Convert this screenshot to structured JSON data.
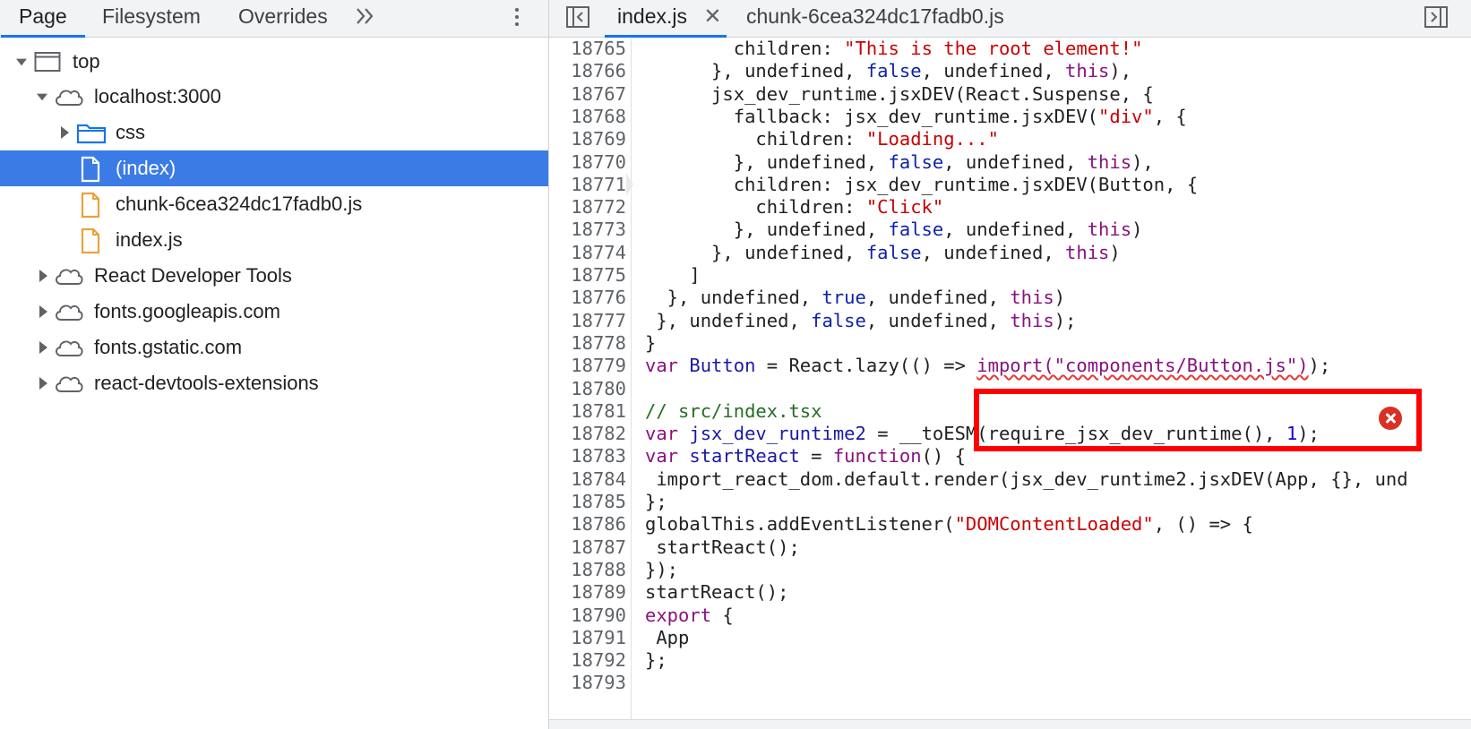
{
  "left_panel": {
    "tabs": [
      {
        "label": "Page",
        "active": true
      },
      {
        "label": "Filesystem",
        "active": false
      },
      {
        "label": "Overrides",
        "active": false
      }
    ],
    "more_tabs_icon": "double-chevron-right-icon",
    "menu_icon": "kebab-menu-icon",
    "tree": [
      {
        "label": "top",
        "type": "frame",
        "expanded": true,
        "depth": 0,
        "selected": false
      },
      {
        "label": "localhost:3000",
        "type": "origin",
        "expanded": true,
        "depth": 1,
        "selected": false
      },
      {
        "label": "css",
        "type": "folder",
        "expanded": false,
        "depth": 2,
        "selected": false
      },
      {
        "label": "(index)",
        "type": "document",
        "depth": 2,
        "selected": true
      },
      {
        "label": "chunk-6cea324dc17fadb0.js",
        "type": "script",
        "depth": 2,
        "selected": false
      },
      {
        "label": "index.js",
        "type": "script",
        "depth": 2,
        "selected": false
      },
      {
        "label": "React Developer Tools",
        "type": "origin",
        "expanded": false,
        "depth": 1,
        "selected": false
      },
      {
        "label": "fonts.googleapis.com",
        "type": "origin",
        "expanded": false,
        "depth": 1,
        "selected": false
      },
      {
        "label": "fonts.gstatic.com",
        "type": "origin",
        "expanded": false,
        "depth": 1,
        "selected": false
      },
      {
        "label": "react-devtools-extensions",
        "type": "origin",
        "expanded": false,
        "depth": 1,
        "selected": false
      }
    ]
  },
  "editor": {
    "tabs": [
      {
        "label": "index.js",
        "active": true,
        "closable": true
      },
      {
        "label": "chunk-6cea324dc17fadb0.js",
        "active": false,
        "closable": false
      }
    ],
    "toggle_navigator_icon": "sidebar-toggle-left-icon",
    "toggle_debugger_icon": "sidebar-toggle-right-icon",
    "current_line": "18771",
    "error_line": "18779",
    "lines": [
      {
        "n": "18765",
        "segs": [
          [
            "p",
            "        children: "
          ],
          [
            "s",
            "\"This is the root element!\""
          ]
        ]
      },
      {
        "n": "18766",
        "segs": [
          [
            "p",
            "      }, undefined, "
          ],
          [
            "b",
            "false"
          ],
          [
            "p",
            ", undefined, "
          ],
          [
            "k",
            "this"
          ],
          [
            "p",
            "),"
          ]
        ]
      },
      {
        "n": "18767",
        "segs": [
          [
            "p",
            "      jsx_dev_runtime.jsxDEV(React.Suspense, {"
          ]
        ]
      },
      {
        "n": "18768",
        "segs": [
          [
            "p",
            "        fallback: jsx_dev_runtime.jsxDEV("
          ],
          [
            "s",
            "\"div\""
          ],
          [
            "p",
            ", {"
          ]
        ]
      },
      {
        "n": "18769",
        "segs": [
          [
            "p",
            "          children: "
          ],
          [
            "s",
            "\"Loading...\""
          ]
        ]
      },
      {
        "n": "18770",
        "segs": [
          [
            "p",
            "        }, undefined, "
          ],
          [
            "b",
            "false"
          ],
          [
            "p",
            ", undefined, "
          ],
          [
            "k",
            "this"
          ],
          [
            "p",
            "),"
          ]
        ]
      },
      {
        "n": "18771",
        "segs": [
          [
            "p",
            "        children: jsx_dev_runtime.jsxDEV(Button, {"
          ]
        ]
      },
      {
        "n": "18772",
        "segs": [
          [
            "p",
            "          children: "
          ],
          [
            "s",
            "\"Click\""
          ]
        ]
      },
      {
        "n": "18773",
        "segs": [
          [
            "p",
            "        }, undefined, "
          ],
          [
            "b",
            "false"
          ],
          [
            "p",
            ", undefined, "
          ],
          [
            "k",
            "this"
          ],
          [
            "p",
            ")"
          ]
        ]
      },
      {
        "n": "18774",
        "segs": [
          [
            "p",
            "      }, undefined, "
          ],
          [
            "b",
            "false"
          ],
          [
            "p",
            ", undefined, "
          ],
          [
            "k",
            "this"
          ],
          [
            "p",
            ")"
          ]
        ]
      },
      {
        "n": "18775",
        "segs": [
          [
            "p",
            "    ]"
          ]
        ]
      },
      {
        "n": "18776",
        "segs": [
          [
            "p",
            "  }, undefined, "
          ],
          [
            "b",
            "true"
          ],
          [
            "p",
            ", undefined, "
          ],
          [
            "k",
            "this"
          ],
          [
            "p",
            ")"
          ]
        ]
      },
      {
        "n": "18777",
        "segs": [
          [
            "p",
            " }, undefined, "
          ],
          [
            "b",
            "false"
          ],
          [
            "p",
            ", undefined, "
          ],
          [
            "k",
            "this"
          ],
          [
            "p",
            ");"
          ]
        ]
      },
      {
        "n": "18778",
        "segs": [
          [
            "p",
            "}"
          ]
        ]
      },
      {
        "n": "18779",
        "segs": [
          [
            "k",
            "var"
          ],
          [
            "p",
            " "
          ],
          [
            "v",
            "Button"
          ],
          [
            "p",
            " = React.lazy(() => "
          ],
          [
            "sq",
            "import(\"components/Button.js\")"
          ],
          [
            "p",
            ");"
          ]
        ]
      },
      {
        "n": "18780",
        "segs": [
          [
            "p",
            ""
          ]
        ]
      },
      {
        "n": "18781",
        "segs": [
          [
            "c",
            "// src/index.tsx"
          ]
        ]
      },
      {
        "n": "18782",
        "segs": [
          [
            "k",
            "var"
          ],
          [
            "p",
            " "
          ],
          [
            "v",
            "jsx_dev_runtime2"
          ],
          [
            "p",
            " = __toESM(require_jsx_dev_runtime(), "
          ],
          [
            "n",
            "1"
          ],
          [
            "p",
            ");"
          ]
        ]
      },
      {
        "n": "18783",
        "segs": [
          [
            "k",
            "var"
          ],
          [
            "p",
            " "
          ],
          [
            "v",
            "startReact"
          ],
          [
            "p",
            " = "
          ],
          [
            "k",
            "function"
          ],
          [
            "p",
            "() {"
          ]
        ]
      },
      {
        "n": "18784",
        "segs": [
          [
            "p",
            " import_react_dom.default.render(jsx_dev_runtime2.jsxDEV(App, {}, und"
          ]
        ]
      },
      {
        "n": "18785",
        "segs": [
          [
            "p",
            "};"
          ]
        ]
      },
      {
        "n": "18786",
        "segs": [
          [
            "p",
            "globalThis.addEventListener("
          ],
          [
            "s",
            "\"DOMContentLoaded\""
          ],
          [
            "p",
            ", () => {"
          ]
        ]
      },
      {
        "n": "18787",
        "segs": [
          [
            "p",
            " startReact();"
          ]
        ]
      },
      {
        "n": "18788",
        "segs": [
          [
            "p",
            "});"
          ]
        ]
      },
      {
        "n": "18789",
        "segs": [
          [
            "p",
            "startReact();"
          ]
        ]
      },
      {
        "n": "18790",
        "segs": [
          [
            "k",
            "export"
          ],
          [
            "p",
            " {"
          ]
        ]
      },
      {
        "n": "18791",
        "segs": [
          [
            "p",
            " App"
          ]
        ]
      },
      {
        "n": "18792",
        "segs": [
          [
            "p",
            "};"
          ]
        ]
      },
      {
        "n": "18793",
        "segs": [
          [
            "p",
            ""
          ]
        ]
      }
    ]
  },
  "colors": {
    "accent": "#1a73e8",
    "selection": "#3b7be6",
    "error_highlight": "#ff0000",
    "folder": "#1a73e8",
    "script_file": "#e8a33c"
  }
}
